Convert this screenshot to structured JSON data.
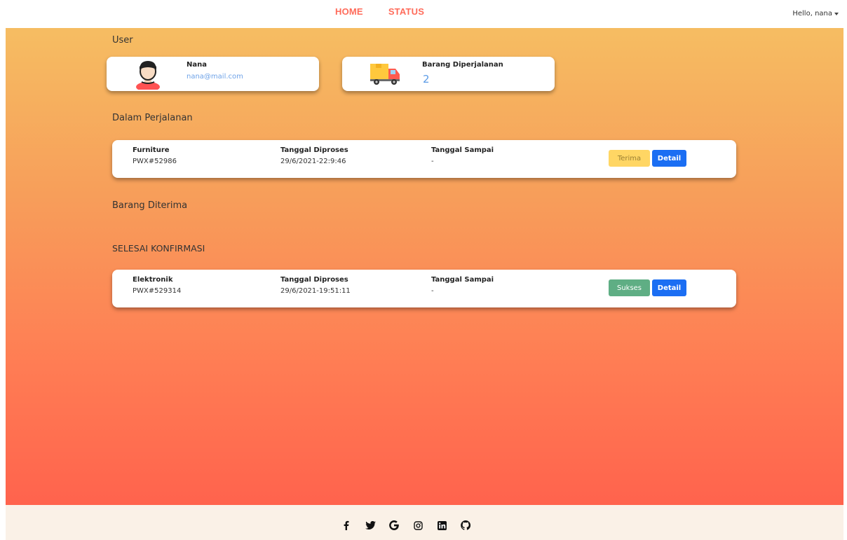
{
  "nav": {
    "links": [
      "HOME",
      "STATUS"
    ],
    "user_greeting": "Hello, nana"
  },
  "sections": {
    "user": "User",
    "in_transit": "Dalam Perjalanan",
    "received": "Barang Diterima",
    "confirmed": "SELESAI KONFIRMASI"
  },
  "profile": {
    "name": "Nana",
    "email": "nana@mail.com",
    "icon": "user-avatar-icon"
  },
  "transit_summary": {
    "label": "Barang Diperjalanan",
    "count": "2",
    "icon": "delivery-truck-icon"
  },
  "columns": {
    "processed": "Tanggal Diproses",
    "arrived": "Tanggal Sampai"
  },
  "in_transit_items": [
    {
      "item": "Furniture",
      "code": "PWX#52986",
      "processed": "29/6/2021-22:9:46",
      "arrived": "-",
      "action": "Terima",
      "detail": "Detail"
    }
  ],
  "confirmed_items": [
    {
      "item": "Elektronik",
      "code": "PWX#529314",
      "processed": "29/6/2021-19:51:11",
      "arrived": "-",
      "status": "Sukses",
      "detail": "Detail"
    }
  ],
  "footer": {
    "social_icons": [
      "facebook-icon",
      "twitter-icon",
      "google-icon",
      "instagram-icon",
      "linkedin-icon",
      "github-icon"
    ]
  },
  "colors": {
    "nav_accent": "#ff6b5a",
    "gradient_top": "#f6bd62",
    "gradient_bottom": "#ff634d",
    "detail_button": "#1b6ef3",
    "terima_button": "#ffcf4a",
    "sukses_button": "#5fae84",
    "footer_bg": "#faf1e7"
  }
}
